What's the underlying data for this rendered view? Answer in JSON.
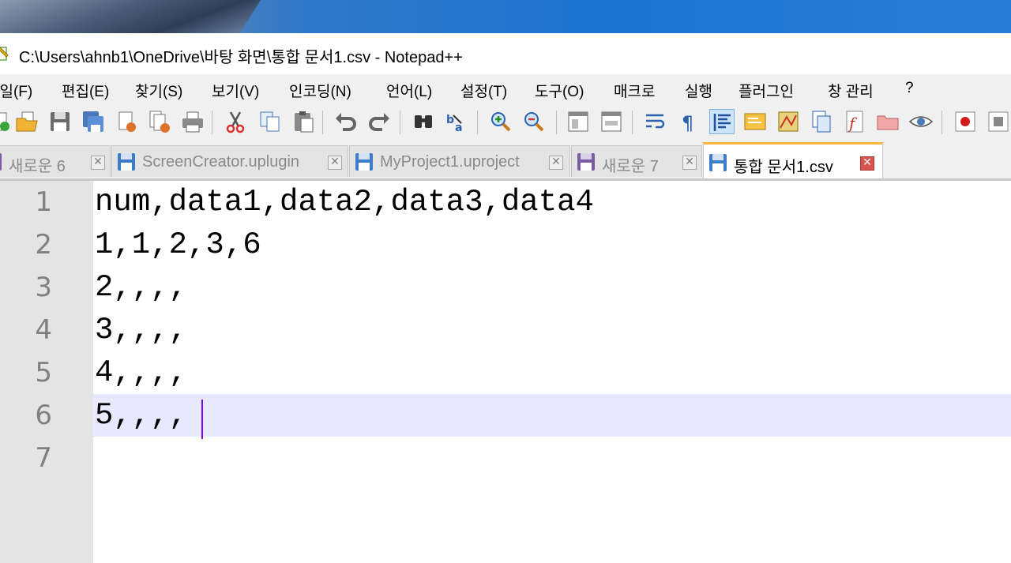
{
  "window": {
    "title": "C:\\Users\\ahnb1\\OneDrive\\바탕 화면\\통합 문서1.csv - Notepad++"
  },
  "menu": [
    {
      "label": "파일(F)"
    },
    {
      "label": "편집(E)"
    },
    {
      "label": "찾기(S)"
    },
    {
      "label": "보기(V)"
    },
    {
      "label": "인코딩(N)"
    },
    {
      "label": "언어(L)"
    },
    {
      "label": "설정(T)"
    },
    {
      "label": "도구(O)"
    },
    {
      "label": "매크로"
    },
    {
      "label": "실행"
    },
    {
      "label": "플러그인"
    },
    {
      "label": "창 관리"
    },
    {
      "label": "?"
    }
  ],
  "toolbar": {
    "icons": [
      "new-file-icon",
      "open-file-icon",
      "save-icon",
      "save-all-icon",
      "close-icon",
      "close-all-icon",
      "print-icon",
      "cut-icon",
      "copy-icon",
      "paste-icon",
      "undo-icon",
      "redo-icon",
      "find-icon",
      "replace-icon",
      "zoom-in-icon",
      "zoom-out-icon",
      "sync-vertical-icon",
      "sync-horizontal-icon",
      "word-wrap-icon",
      "show-all-chars-icon",
      "indent-guide-icon",
      "udl-icon",
      "document-map-icon",
      "document-list-icon",
      "function-list-icon",
      "folder-workspace-icon",
      "monitoring-icon",
      "record-macro-icon",
      "stop-record-icon"
    ]
  },
  "tabs": [
    {
      "label": "새로운 6",
      "active": false,
      "icon": "floppy-purple-icon"
    },
    {
      "label": "ScreenCreator.uplugin",
      "active": false,
      "icon": "floppy-blue-icon"
    },
    {
      "label": "MyProject1.uproject",
      "active": false,
      "icon": "floppy-blue-icon"
    },
    {
      "label": "새로운 7",
      "active": false,
      "icon": "floppy-purple-icon"
    },
    {
      "label": "통합 문서1.csv",
      "active": true,
      "icon": "floppy-blue-icon"
    }
  ],
  "editor": {
    "current_line": 6,
    "lines": [
      {
        "num": "1",
        "text": "num,data1,data2,data3,data4"
      },
      {
        "num": "2",
        "text": "1,1,2,3,6"
      },
      {
        "num": "3",
        "text": "2,,,,"
      },
      {
        "num": "4",
        "text": "3,,,,"
      },
      {
        "num": "5",
        "text": "4,,,,"
      },
      {
        "num": "6",
        "text": "5,,,,"
      },
      {
        "num": "7",
        "text": ""
      }
    ]
  },
  "colors": {
    "current_line_bg": "#e8e8ff",
    "caret": "#8000ff",
    "active_tab_accent": "#fab640",
    "gutter_bg": "#e4e4e4"
  }
}
